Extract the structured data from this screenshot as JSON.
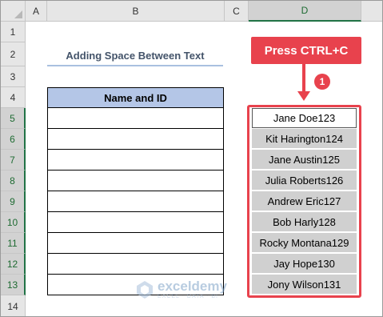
{
  "columns": [
    "A",
    "B",
    "C",
    "D"
  ],
  "rows": [
    "1",
    "2",
    "3",
    "4",
    "5",
    "6",
    "7",
    "8",
    "9",
    "10",
    "11",
    "12",
    "13",
    "14"
  ],
  "title": "Adding Space Between Text",
  "table": {
    "header": "Name and ID",
    "rows": [
      "",
      "",
      "",
      "",
      "",
      "",
      "",
      "",
      ""
    ]
  },
  "callout": {
    "label": "Press CTRL+C",
    "step": "1"
  },
  "source_list": [
    "Jane Doe123",
    "Kit Harington124",
    "Jane Austin125",
    "Julia Roberts126",
    "Andrew Eric127",
    "Bob Harly128",
    "Rocky Montana129",
    "Jay Hope130",
    "Jony Wilson131"
  ],
  "watermark": {
    "brand": "exceldemy",
    "tagline": "EXCEL · DATA · BI"
  },
  "colors": {
    "accent": "#e8424d",
    "header_fill": "#b4c6e7",
    "excel_green": "#217346"
  }
}
